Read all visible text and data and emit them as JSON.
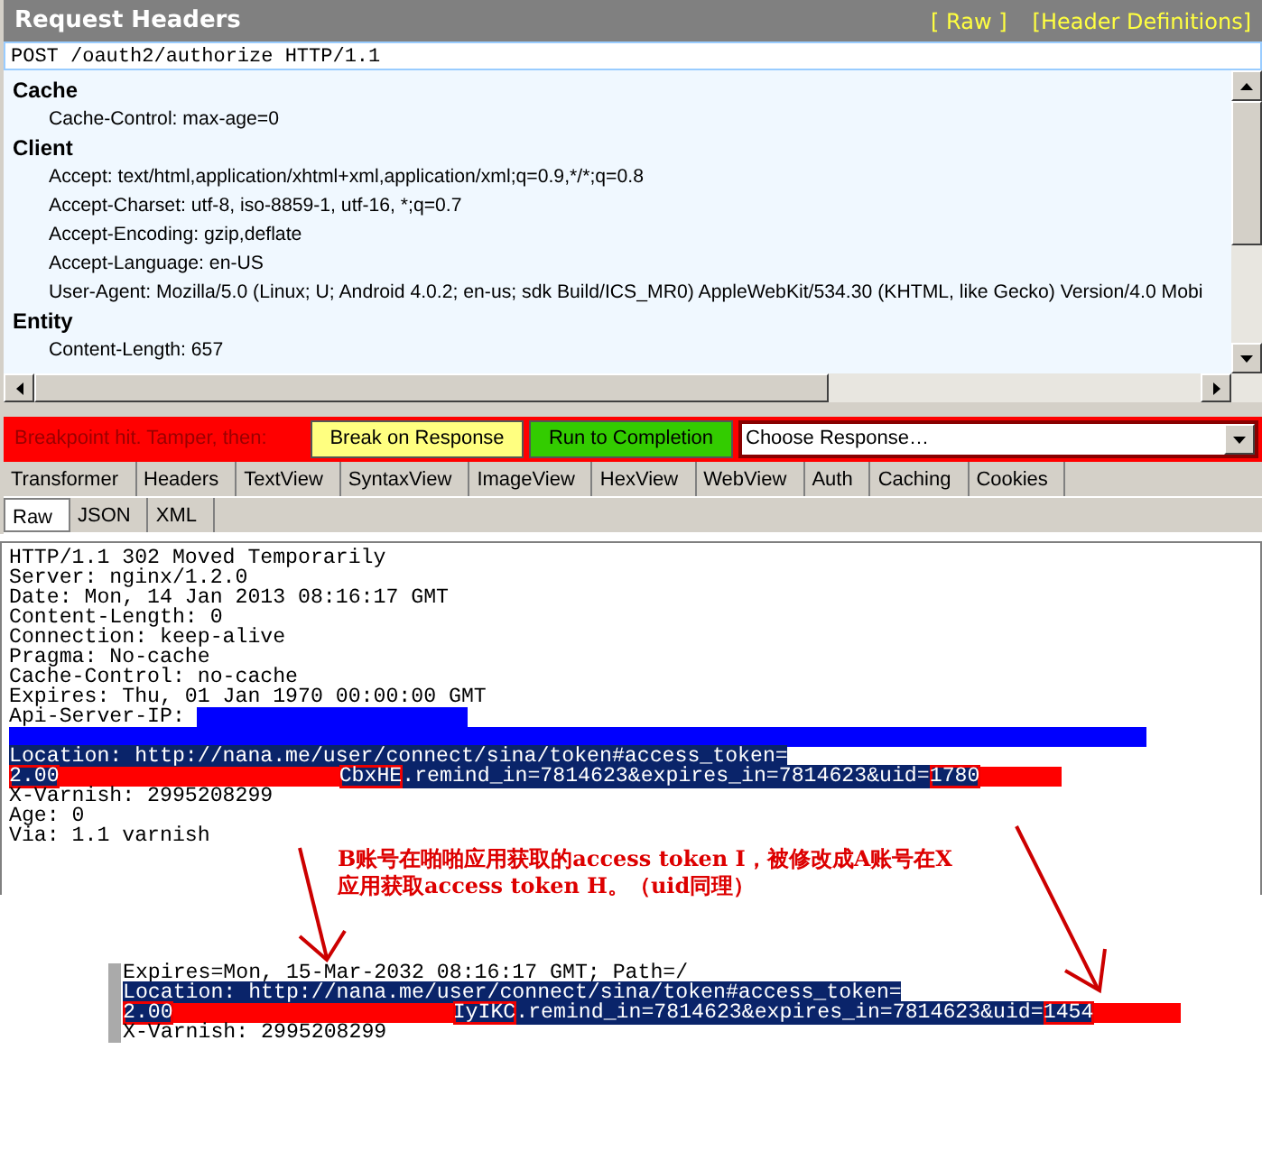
{
  "request_headers": {
    "title": "Request Headers",
    "links": [
      "[ Raw ]",
      "[Header Definitions]"
    ],
    "request_line": "POST /oauth2/authorize HTTP/1.1",
    "groups": [
      {
        "name": "Cache",
        "headers": [
          "Cache-Control: max-age=0"
        ]
      },
      {
        "name": "Client",
        "headers": [
          "Accept: text/html,application/xhtml+xml,application/xml;q=0.9,*/*;q=0.8",
          "Accept-Charset: utf-8, iso-8859-1, utf-16, *;q=0.7",
          "Accept-Encoding: gzip,deflate",
          "Accept-Language: en-US",
          "User-Agent: Mozilla/5.0 (Linux; U; Android 4.0.2; en-us; sdk Build/ICS_MR0) AppleWebKit/534.30 (KHTML, like Gecko) Version/4.0 Mobi"
        ]
      },
      {
        "name": "Entity",
        "headers": [
          "Content-Length: 657"
        ]
      }
    ]
  },
  "breakpoint_bar": {
    "message": "Breakpoint hit. Tamper, then:",
    "buttons": [
      {
        "label": "Break on Response",
        "color": "#ffff80"
      },
      {
        "label": "Run to Completion",
        "color": "#33cc00"
      }
    ],
    "response_select": {
      "value": "Choose Response…"
    }
  },
  "response_tabs": [
    {
      "label": "Transformer",
      "selected": false
    },
    {
      "label": "Headers",
      "selected": false
    },
    {
      "label": "TextView",
      "selected": false
    },
    {
      "label": "SyntaxView",
      "selected": false
    },
    {
      "label": "ImageView",
      "selected": false
    },
    {
      "label": "HexView",
      "selected": false
    },
    {
      "label": "WebView",
      "selected": false
    },
    {
      "label": "Auth",
      "selected": false
    },
    {
      "label": "Caching",
      "selected": false
    },
    {
      "label": "Cookies",
      "selected": false
    }
  ],
  "response_subtabs": [
    {
      "label": "Raw",
      "selected": true
    },
    {
      "label": "JSON",
      "selected": false
    },
    {
      "label": "XML",
      "selected": false
    }
  ],
  "response_lines": [
    {
      "selected": false,
      "segments": [
        {
          "kind": "text",
          "text": "HTTP/1.1 302 Moved Temporarily"
        }
      ]
    },
    {
      "selected": false,
      "segments": [
        {
          "kind": "text",
          "text": "Server: nginx/1.2.0"
        }
      ]
    },
    {
      "selected": false,
      "segments": [
        {
          "kind": "text",
          "text": "Date: Mon, 14 Jan 2013 08:16:17 GMT"
        }
      ]
    },
    {
      "selected": false,
      "segments": [
        {
          "kind": "text",
          "text": "Content-Length: 0"
        }
      ]
    },
    {
      "selected": false,
      "segments": [
        {
          "kind": "text",
          "text": "Connection: keep-alive"
        }
      ]
    },
    {
      "selected": false,
      "segments": [
        {
          "kind": "text",
          "text": "Pragma: No-cache"
        }
      ]
    },
    {
      "selected": false,
      "segments": [
        {
          "kind": "text",
          "text": "Cache-Control: no-cache"
        }
      ]
    },
    {
      "selected": false,
      "segments": [
        {
          "kind": "text",
          "text": "Expires: Thu, 01 Jan 1970 00:00:00 GMT"
        }
      ]
    },
    {
      "selected": false,
      "segments": [
        {
          "kind": "text",
          "text": "Api-Server-IP: "
        },
        {
          "kind": "short_redaction",
          "color": "#0000ff"
        }
      ]
    },
    {
      "selected": false,
      "segments": [
        {
          "kind": "line_redaction",
          "color": "#0000ff"
        }
      ]
    },
    {
      "selected": true,
      "segments": [
        {
          "kind": "text",
          "text": "Location: http://nana.me/user/connect/sina/token#access_token="
        }
      ]
    },
    {
      "selected": true,
      "segments": [
        {
          "kind": "boxed",
          "text": "2.00"
        },
        {
          "kind": "token_redaction",
          "color": "#ff0000"
        },
        {
          "kind": "boxed",
          "text": "CbxHE"
        },
        {
          "kind": "text",
          "text": ".remind_in=7814623&expires_in=7814623&uid="
        },
        {
          "kind": "boxed",
          "text": "1780"
        },
        {
          "kind": "tail_redaction",
          "color": "#ff0000"
        }
      ]
    },
    {
      "selected": false,
      "segments": [
        {
          "kind": "text",
          "text": "X-Varnish: 2995208299"
        }
      ]
    },
    {
      "selected": false,
      "segments": [
        {
          "kind": "text",
          "text": "Age: 0"
        }
      ]
    },
    {
      "selected": false,
      "segments": [
        {
          "kind": "text",
          "text": "Via: 1.1 varnish"
        }
      ]
    }
  ],
  "note": "B账号在啪啪应用获取的access token I，被修改成A账号在X应用获取access token H。（uid同理）",
  "snippet_lines": [
    {
      "selected": false,
      "segments": [
        {
          "kind": "text",
          "text": "Expires=Mon, 15-Mar-2032 08:16:17 GMT; Path=/"
        }
      ]
    },
    {
      "selected": true,
      "segments": [
        {
          "kind": "text",
          "text": "Location: http://nana.me/user/connect/sina/token#access_token="
        }
      ]
    },
    {
      "selected": true,
      "segments": [
        {
          "kind": "boxed",
          "text": "2.00"
        },
        {
          "kind": "token_redaction",
          "color": "#ff0000"
        },
        {
          "kind": "boxed",
          "text": "IyIKC"
        },
        {
          "kind": "text",
          "text": ".remind_in=7814623&expires_in=7814623&uid="
        },
        {
          "kind": "boxed",
          "text": "1454"
        },
        {
          "kind": "tail_redaction",
          "color": "#ff0000"
        }
      ]
    },
    {
      "selected": false,
      "segments": [
        {
          "kind": "text",
          "text": "X-Varnish: 2995208299"
        }
      ]
    }
  ]
}
